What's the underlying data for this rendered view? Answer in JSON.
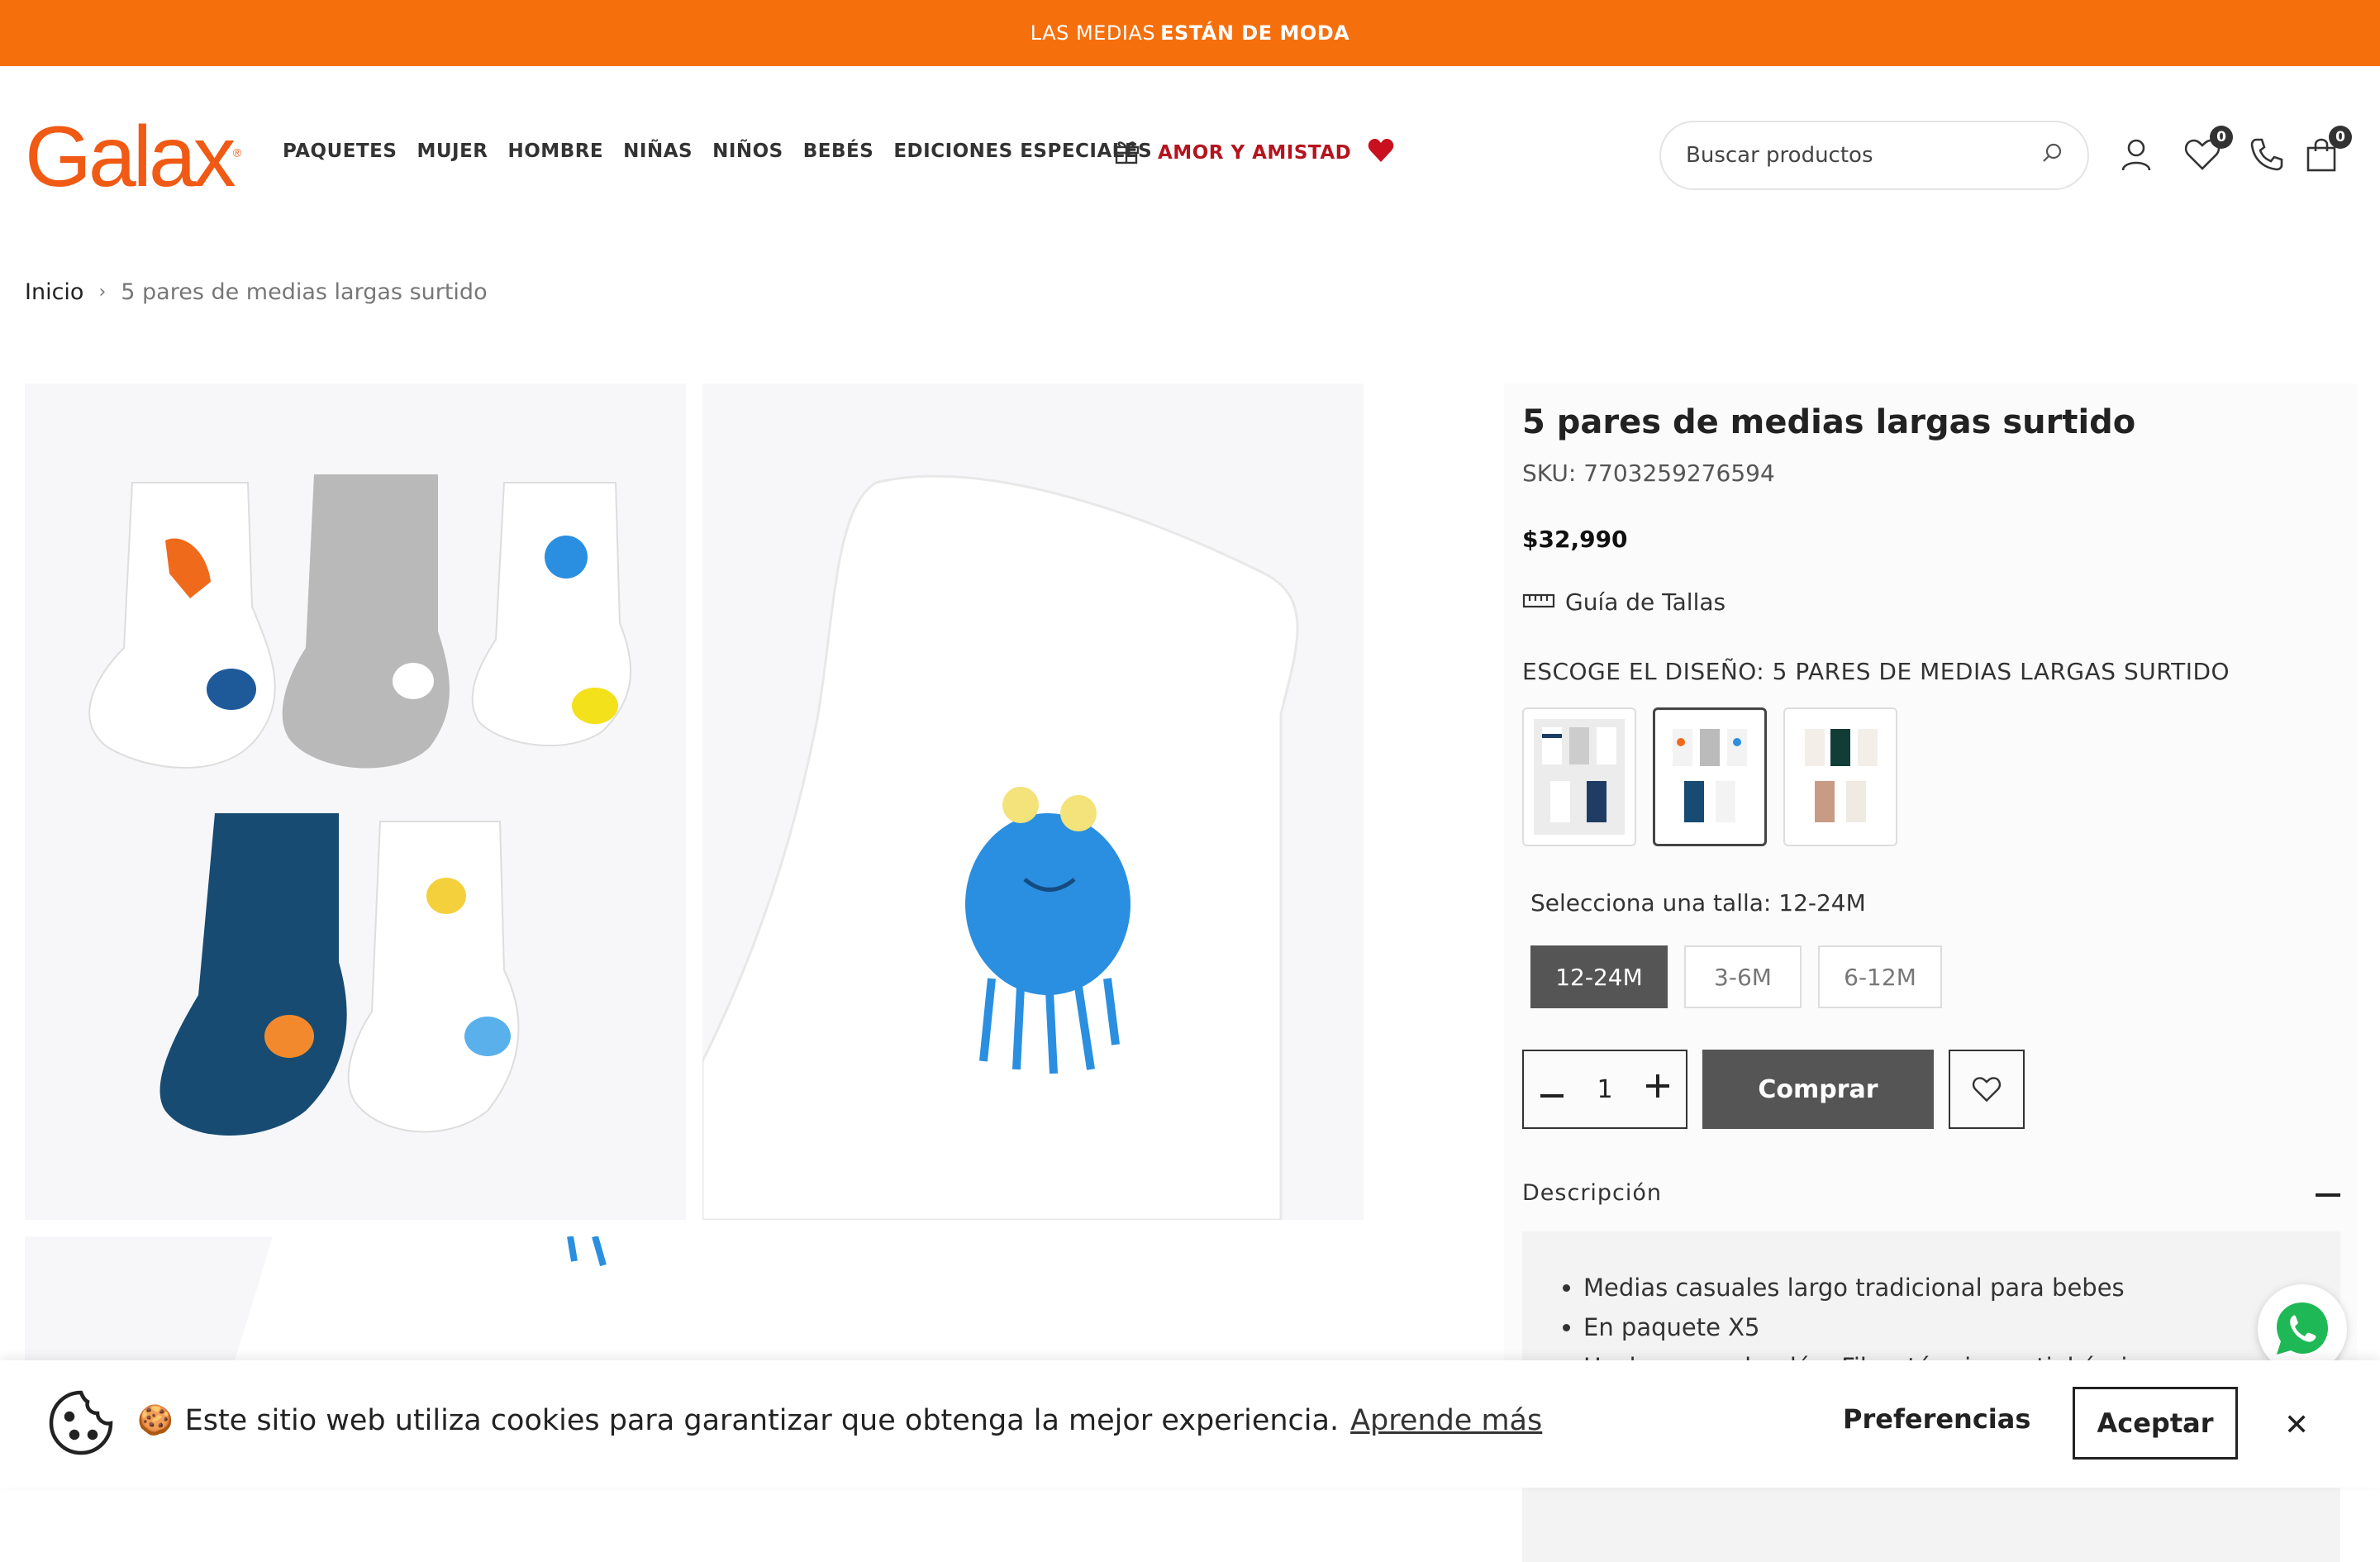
{
  "announcement": {
    "prefix": "LAS MEDIAS",
    "highlight": "ESTÁN DE MODA"
  },
  "header": {
    "logo": "Galax",
    "nav": [
      "PAQUETES",
      "MUJER",
      "HOMBRE",
      "NIÑAS",
      "NIÑOS",
      "BEBÉS",
      "EDICIONES ESPECIALES"
    ],
    "promo_label": "AMOR Y AMISTAD",
    "search_placeholder": "Buscar productos",
    "wishlist_count": "0",
    "cart_count": "0"
  },
  "breadcrumb": {
    "home": "Inicio",
    "current": "5 pares de medias largas surtido"
  },
  "product": {
    "title": "5 pares de medias largas surtido",
    "sku": "SKU: 7703259276594",
    "price": "$32,990",
    "size_guide": "Guía de Tallas",
    "design_label": "ESCOGE EL DISEÑO: 5 PARES DE MEDIAS LARGAS SURTIDO",
    "size_label": "Selecciona una talla: 12-24M",
    "sizes": [
      "12-24M",
      "3-6M",
      "6-12M"
    ],
    "quantity": "1",
    "buy_label": "Comprar",
    "description_title": "Descripción",
    "description_items": [
      "Medias casuales largo tradicional para bebes",
      "En paquete X5",
      "Hechas con algodón. Fibra térmica antial érgica"
    ]
  },
  "cookie": {
    "emoji": "🍪",
    "message": "Este sitio web utiliza cookies para garantizar que obtenga la mejor experiencia.",
    "learn_more": "Aprende más",
    "preferences": "Preferencias",
    "accept": "Aceptar"
  },
  "colors": {
    "brand_orange": "#f66f0d",
    "logo_orange": "#f05a14",
    "promo_red": "#b4141e",
    "button_gray": "#555555"
  }
}
